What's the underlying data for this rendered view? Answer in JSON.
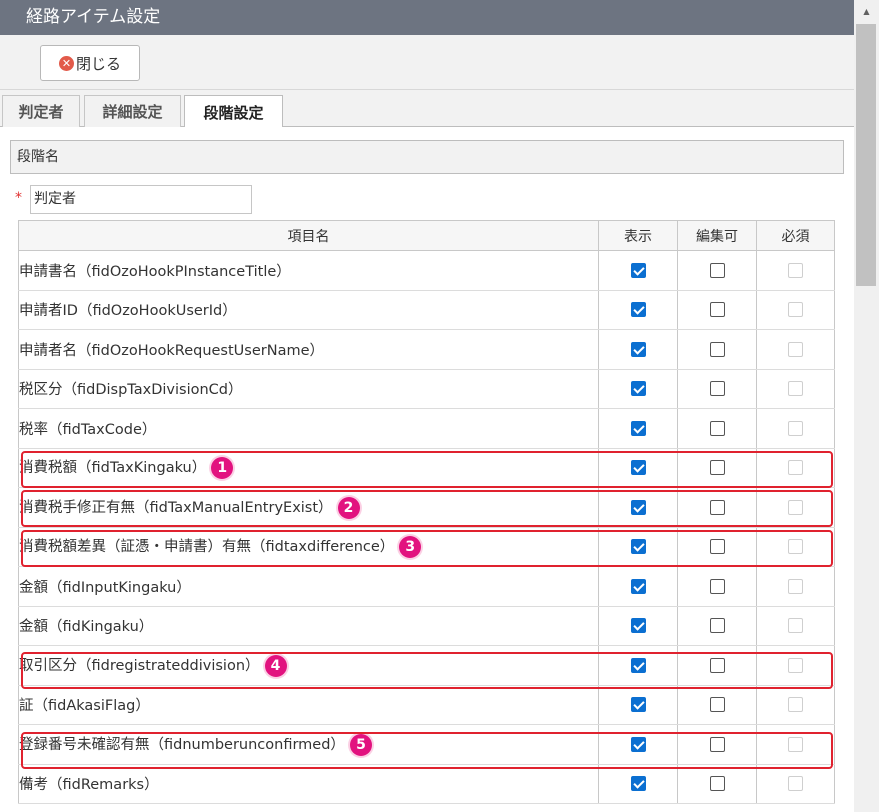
{
  "window": {
    "title": "経路アイテム設定"
  },
  "toolbar": {
    "close_label": "閉じる"
  },
  "tabs": [
    {
      "label": "判定者"
    },
    {
      "label": "詳細設定"
    },
    {
      "label": "段階設定"
    }
  ],
  "stage": {
    "section_label": "段階名",
    "required_mark": "*",
    "name_value": "判定者"
  },
  "table": {
    "headers": [
      "項目名",
      "表示",
      "編集可",
      "必須"
    ],
    "rows": [
      {
        "label": "申請書名（fidOzoHookPInstanceTitle）",
        "badge": "",
        "display": true,
        "editable": false
      },
      {
        "label": "申請者ID（fidOzoHookUserId）",
        "badge": "",
        "display": true,
        "editable": false
      },
      {
        "label": "申請者名（fidOzoHookRequestUserName）",
        "badge": "",
        "display": true,
        "editable": false
      },
      {
        "label": "税区分（fidDispTaxDivisionCd）",
        "badge": "",
        "display": true,
        "editable": false
      },
      {
        "label": "税率（fidTaxCode）",
        "badge": "",
        "display": true,
        "editable": false
      },
      {
        "label": "消費税額（fidTaxKingaku）",
        "badge": "1",
        "display": true,
        "editable": false
      },
      {
        "label": "消費税手修正有無（fidTaxManualEntryExist）",
        "badge": "2",
        "display": true,
        "editable": false
      },
      {
        "label": "消費税額差異（証憑・申請書）有無（fidtaxdifference）",
        "badge": "3",
        "display": true,
        "editable": false
      },
      {
        "label": "金額（fidInputKingaku）",
        "badge": "",
        "display": true,
        "editable": false
      },
      {
        "label": "金額（fidKingaku）",
        "badge": "",
        "display": true,
        "editable": false
      },
      {
        "label": "取引区分（fidregistrateddivision）",
        "badge": "4",
        "display": true,
        "editable": false
      },
      {
        "label": "証（fidAkasiFlag）",
        "badge": "",
        "display": true,
        "editable": false
      },
      {
        "label": "登録番号未確認有無（fidnumberunconfirmed）",
        "badge": "5",
        "display": true,
        "editable": false
      },
      {
        "label": "備考（fidRemarks）",
        "badge": "",
        "display": true,
        "editable": false
      }
    ]
  },
  "colors": {
    "title_bar": "#6d7481",
    "checkbox_checked": "#0b6fd1",
    "highlight_border": "#e0222f",
    "badge": "#e2127f"
  }
}
